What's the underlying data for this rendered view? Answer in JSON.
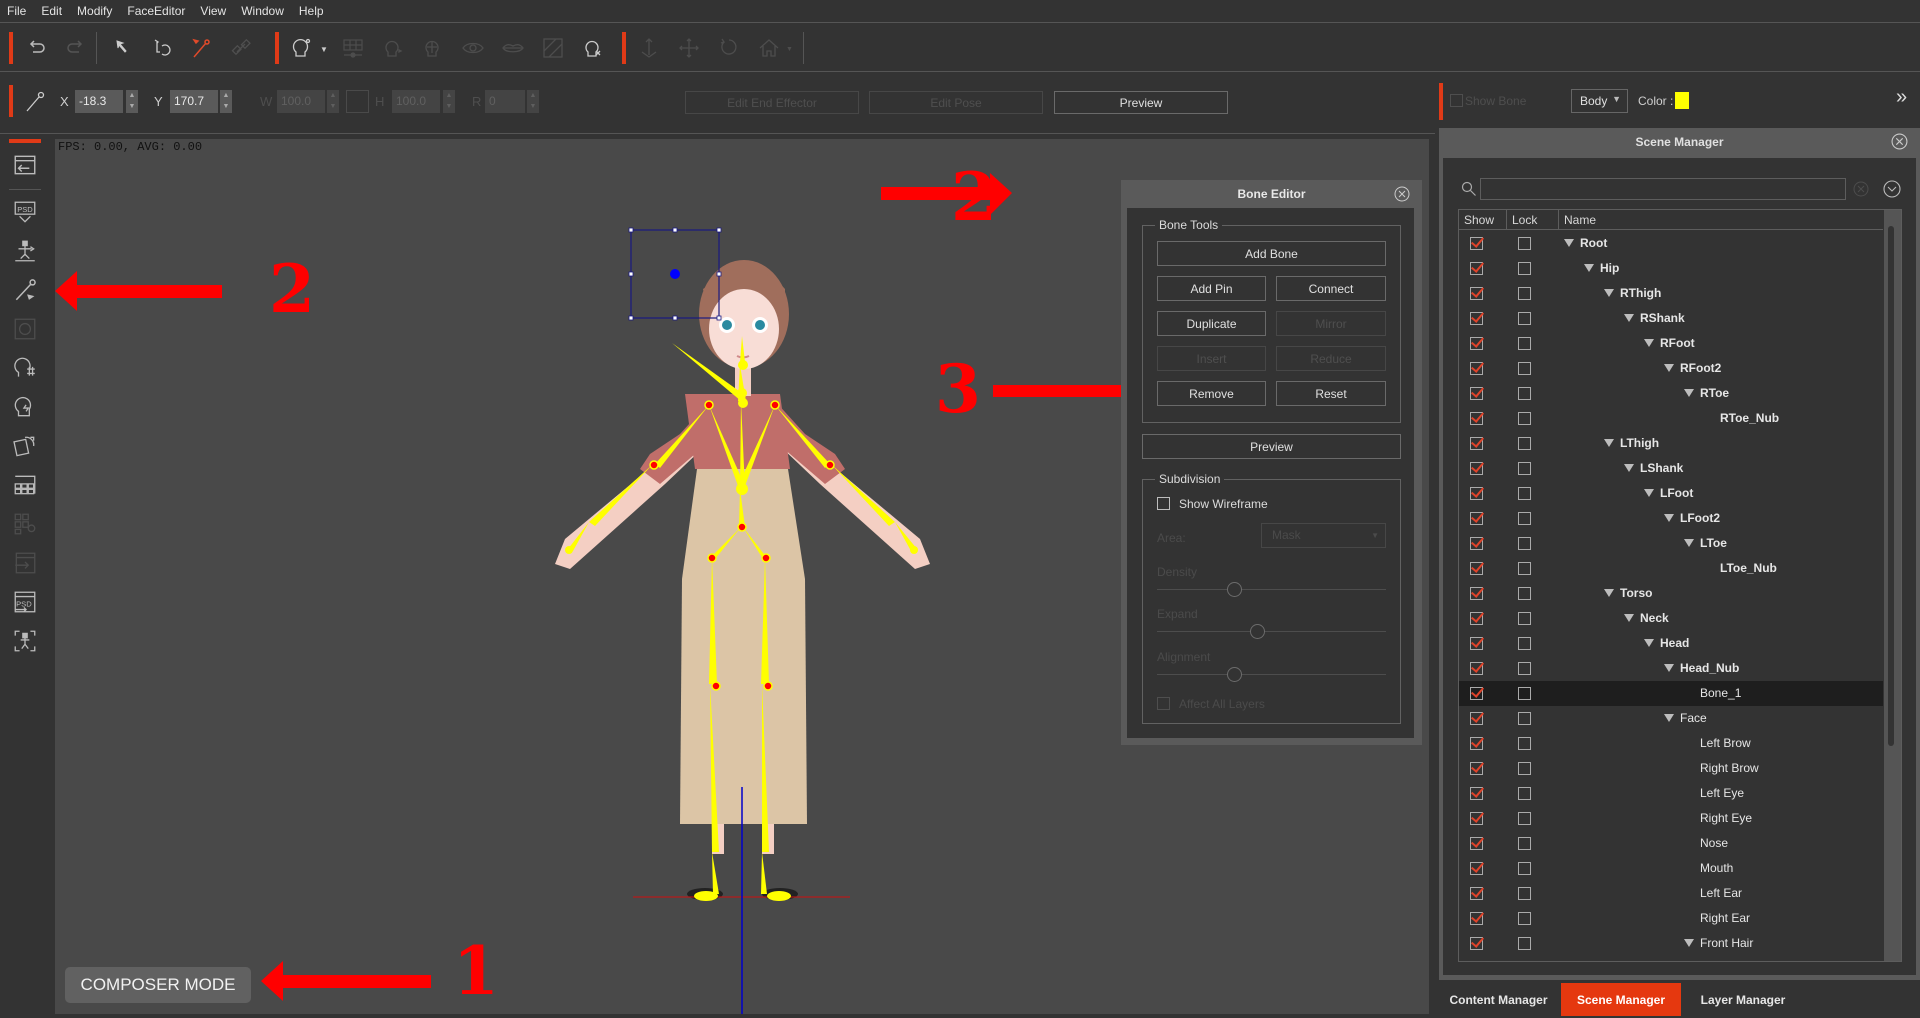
{
  "menu": [
    "File",
    "Edit",
    "Modify",
    "FaceEditor",
    "View",
    "Window",
    "Help"
  ],
  "toolbar1": {
    "icons": [
      "undo-icon",
      "redo-icon",
      "select-arrow-icon",
      "transform-icon",
      "bone-pin-tool-icon",
      "link-icon",
      "face-head-icon",
      "grid-icon",
      "head-turn-icon",
      "head-sprite-icon",
      "eye-icon",
      "lips-icon",
      "mask-icon",
      "head-remove-icon",
      "move-down-icon",
      "move-icon",
      "rotate-icon",
      "home-icon"
    ]
  },
  "transform": {
    "x_label": "X",
    "x_value": "-18.3",
    "y_label": "Y",
    "y_value": "170.7",
    "w_label": "W",
    "w_value": "100.0",
    "h_label": "H",
    "h_value": "100.0",
    "r_label": "R",
    "r_value": "0"
  },
  "toolbar2": {
    "edit_end_effector": "Edit End Effector",
    "edit_pose": "Edit Pose",
    "preview": "Preview",
    "show_bone": "Show Bone",
    "body_select": "Body",
    "color_label": "Color :",
    "bone_color": "#ffff00",
    "expand": "»"
  },
  "viewport": {
    "fps": "FPS: 0.00, AVG: 0.00",
    "mode": "COMPOSER MODE"
  },
  "bone_editor": {
    "title": "Bone Editor",
    "bone_tools_title": "Bone Tools",
    "add_bone": "Add Bone",
    "add_pin": "Add Pin",
    "connect": "Connect",
    "duplicate": "Duplicate",
    "mirror": "Mirror",
    "insert": "Insert",
    "reduce": "Reduce",
    "remove": "Remove",
    "reset": "Reset",
    "preview": "Preview",
    "subdivision_title": "Subdivision",
    "show_wireframe": "Show Wireframe",
    "area_label": "Area:",
    "area_value": "Mask",
    "density_label": "Density",
    "density_value": 0.34,
    "expand_label": "Expand",
    "expand_value": 0.44,
    "alignment_label": "Alignment",
    "alignment_value": 0.34,
    "affect_all_layers": "Affect All  Layers"
  },
  "scene_manager": {
    "title": "Scene Manager",
    "search_placeholder": "",
    "columns": [
      "Show",
      "Lock",
      "Name"
    ],
    "rows": [
      {
        "name": "Root",
        "depth": 0,
        "expand": true,
        "bold": true,
        "show": true,
        "lock": false
      },
      {
        "name": "Hip",
        "depth": 1,
        "expand": true,
        "bold": true,
        "show": true,
        "lock": false
      },
      {
        "name": "RThigh",
        "depth": 2,
        "expand": true,
        "bold": true,
        "show": true,
        "lock": false
      },
      {
        "name": "RShank",
        "depth": 3,
        "expand": true,
        "bold": true,
        "show": true,
        "lock": false
      },
      {
        "name": "RFoot",
        "depth": 4,
        "expand": true,
        "bold": true,
        "show": true,
        "lock": false
      },
      {
        "name": "RFoot2",
        "depth": 5,
        "expand": true,
        "bold": true,
        "show": true,
        "lock": false
      },
      {
        "name": "RToe",
        "depth": 6,
        "expand": true,
        "bold": true,
        "show": true,
        "lock": false
      },
      {
        "name": "RToe_Nub",
        "depth": 7,
        "expand": false,
        "bold": true,
        "show": true,
        "lock": false
      },
      {
        "name": "LThigh",
        "depth": 2,
        "expand": true,
        "bold": true,
        "show": true,
        "lock": false
      },
      {
        "name": "LShank",
        "depth": 3,
        "expand": true,
        "bold": true,
        "show": true,
        "lock": false
      },
      {
        "name": "LFoot",
        "depth": 4,
        "expand": true,
        "bold": true,
        "show": true,
        "lock": false
      },
      {
        "name": "LFoot2",
        "depth": 5,
        "expand": true,
        "bold": true,
        "show": true,
        "lock": false
      },
      {
        "name": "LToe",
        "depth": 6,
        "expand": true,
        "bold": true,
        "show": true,
        "lock": false
      },
      {
        "name": "LToe_Nub",
        "depth": 7,
        "expand": false,
        "bold": true,
        "show": true,
        "lock": false
      },
      {
        "name": "Torso",
        "depth": 2,
        "expand": true,
        "bold": true,
        "show": true,
        "lock": false
      },
      {
        "name": "Neck",
        "depth": 3,
        "expand": true,
        "bold": true,
        "show": true,
        "lock": false
      },
      {
        "name": "Head",
        "depth": 4,
        "expand": true,
        "bold": true,
        "show": true,
        "lock": false
      },
      {
        "name": "Head_Nub",
        "depth": 5,
        "expand": true,
        "bold": true,
        "show": true,
        "lock": false
      },
      {
        "name": "Bone_1",
        "depth": 6,
        "expand": false,
        "bold": false,
        "show": true,
        "lock": false,
        "selected": true
      },
      {
        "name": "Face",
        "depth": 5,
        "expand": true,
        "bold": false,
        "show": true,
        "lock": false
      },
      {
        "name": "Left Brow",
        "depth": 6,
        "expand": false,
        "bold": false,
        "show": true,
        "lock": false
      },
      {
        "name": "Right Brow",
        "depth": 6,
        "expand": false,
        "bold": false,
        "show": true,
        "lock": false
      },
      {
        "name": "Left Eye",
        "depth": 6,
        "expand": false,
        "bold": false,
        "show": true,
        "lock": false
      },
      {
        "name": "Right Eye",
        "depth": 6,
        "expand": false,
        "bold": false,
        "show": true,
        "lock": false
      },
      {
        "name": "Nose",
        "depth": 6,
        "expand": false,
        "bold": false,
        "show": true,
        "lock": false
      },
      {
        "name": "Mouth",
        "depth": 6,
        "expand": false,
        "bold": false,
        "show": true,
        "lock": false
      },
      {
        "name": "Left Ear",
        "depth": 6,
        "expand": false,
        "bold": false,
        "show": true,
        "lock": false
      },
      {
        "name": "Right Ear",
        "depth": 6,
        "expand": false,
        "bold": false,
        "show": true,
        "lock": false
      },
      {
        "name": "Front Hair",
        "depth": 6,
        "expand": true,
        "bold": false,
        "show": true,
        "lock": false
      }
    ]
  },
  "bottom_tabs": [
    {
      "label": "Content Manager",
      "active": false
    },
    {
      "label": "Scene Manager",
      "active": true
    },
    {
      "label": "Layer Manager",
      "active": false
    }
  ],
  "annotations": {
    "n1": "1",
    "n2a": "2",
    "n2b": "2",
    "n3": "3"
  },
  "colors": {
    "accent": "#e5380f",
    "annotation": "#ff0000",
    "bone": "#ffff00",
    "joint": "#ff0000"
  }
}
